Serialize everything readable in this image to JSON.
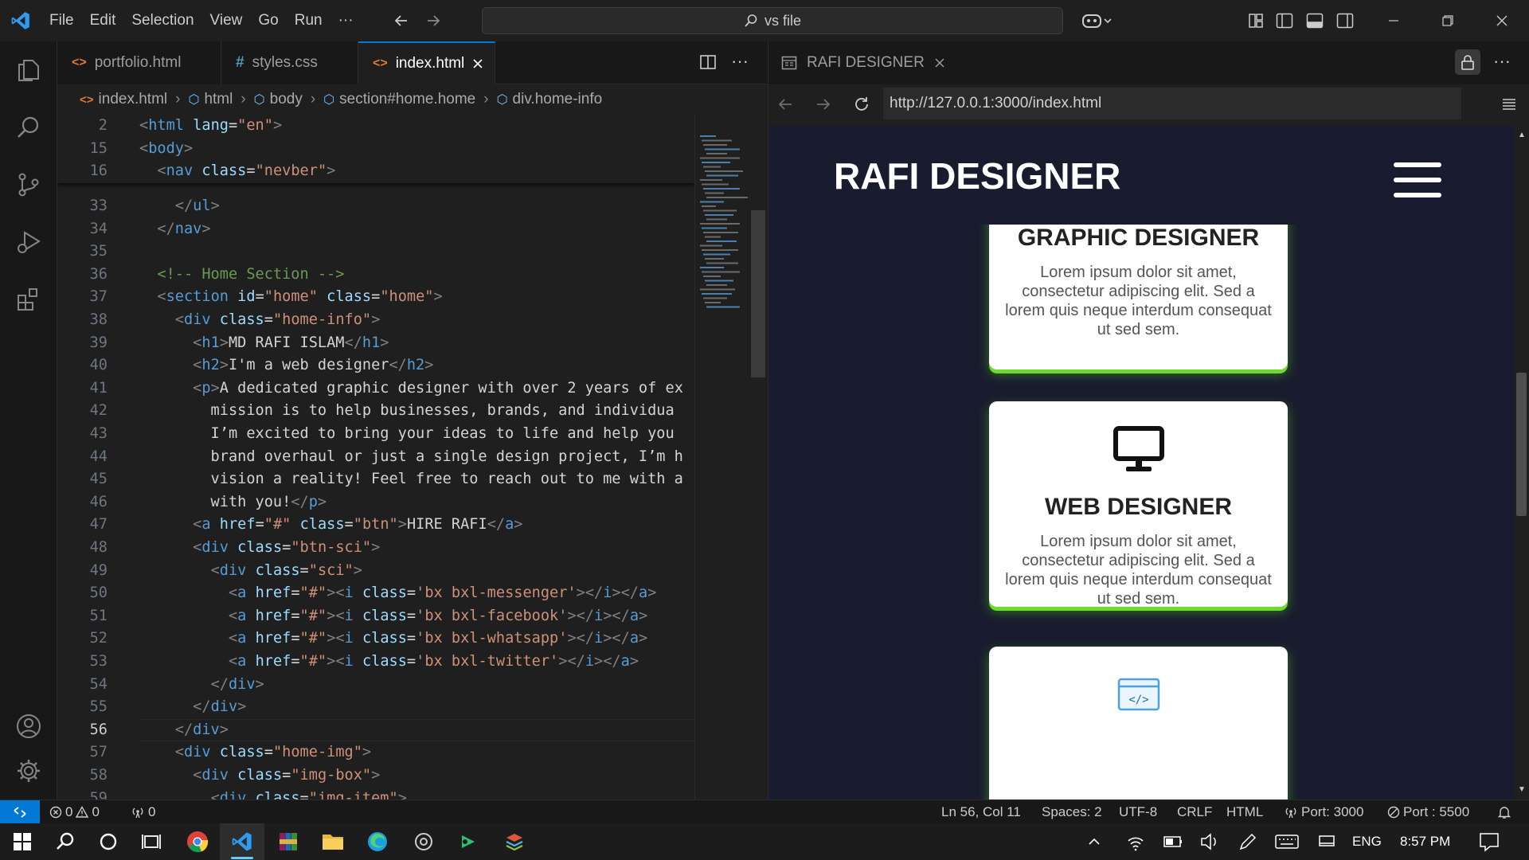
{
  "titlebar": {
    "menu": [
      "File",
      "Edit",
      "Selection",
      "View",
      "Go",
      "Run",
      "···"
    ],
    "search_text": "vs file"
  },
  "tabs": [
    {
      "label": "portfolio.html",
      "icon": "html-file-icon"
    },
    {
      "label": "styles.css",
      "icon": "css-file-icon"
    },
    {
      "label": "index.html",
      "icon": "html-file-icon",
      "active": true
    }
  ],
  "breadcrumb": [
    "index.html",
    "html",
    "body",
    "section#home.home",
    "div.home-info"
  ],
  "sticky_lines": [
    {
      "n": "2",
      "html": "<span class='t-br'>&lt;</span><span class='t-tag'>html</span> <span class='t-attr'>lang</span><span class='t-txt'>=</span><span class='t-val'>\"en\"</span><span class='t-br'>&gt;</span>"
    },
    {
      "n": "15",
      "html": "<span class='t-br'>&lt;</span><span class='t-tag'>body</span><span class='t-br'>&gt;</span>"
    },
    {
      "n": "16",
      "html": "  <span class='t-br'>&lt;</span><span class='t-tag'>nav</span> <span class='t-attr'>class</span><span class='t-txt'>=</span><span class='t-val'>\"nevber\"</span><span class='t-br'>&gt;</span>"
    }
  ],
  "code_lines": [
    {
      "n": "33",
      "html": "    <span class='t-br'>&lt;/</span><span class='t-tag'>ul</span><span class='t-br'>&gt;</span>"
    },
    {
      "n": "34",
      "html": "  <span class='t-br'>&lt;/</span><span class='t-tag'>nav</span><span class='t-br'>&gt;</span>"
    },
    {
      "n": "35",
      "html": ""
    },
    {
      "n": "36",
      "html": "  <span class='t-cmt'>&lt;!-- Home Section --&gt;</span>"
    },
    {
      "n": "37",
      "html": "  <span class='t-br'>&lt;</span><span class='t-tag'>section</span> <span class='t-attr'>id</span><span class='t-txt'>=</span><span class='t-val'>\"home\"</span> <span class='t-attr'>class</span><span class='t-txt'>=</span><span class='t-val'>\"home\"</span><span class='t-br'>&gt;</span>"
    },
    {
      "n": "38",
      "html": "    <span class='t-br'>&lt;</span><span class='t-tag'>div</span> <span class='t-attr'>class</span><span class='t-txt'>=</span><span class='t-val'>\"home-info\"</span><span class='t-br'>&gt;</span>"
    },
    {
      "n": "39",
      "html": "      <span class='t-br'>&lt;</span><span class='t-tag'>h1</span><span class='t-br'>&gt;</span><span class='t-txt'>MD RAFI ISLAM</span><span class='t-br'>&lt;/</span><span class='t-tag'>h1</span><span class='t-br'>&gt;</span>"
    },
    {
      "n": "40",
      "html": "      <span class='t-br'>&lt;</span><span class='t-tag'>h2</span><span class='t-br'>&gt;</span><span class='t-txt'>I'm a web designer</span><span class='t-br'>&lt;/</span><span class='t-tag'>h2</span><span class='t-br'>&gt;</span>"
    },
    {
      "n": "41",
      "html": "      <span class='t-br'>&lt;</span><span class='t-tag'>p</span><span class='t-br'>&gt;</span><span class='t-txt'>A dedicated graphic designer with over 2 years of ex</span>"
    },
    {
      "n": "42",
      "html": "<span class='t-txt'>        mission is to help businesses, brands, and individua</span>"
    },
    {
      "n": "43",
      "html": "<span class='t-txt'>        I’m excited to bring your ideas to life and help you</span>"
    },
    {
      "n": "44",
      "html": "<span class='t-txt'>        brand overhaul or just a single design project, I’m h</span>"
    },
    {
      "n": "45",
      "html": "<span class='t-txt'>        vision a reality! Feel free to reach out to me with a</span>"
    },
    {
      "n": "46",
      "html": "<span class='t-txt'>        with you!</span><span class='t-br'>&lt;/</span><span class='t-tag'>p</span><span class='t-br'>&gt;</span>"
    },
    {
      "n": "47",
      "html": "      <span class='t-br'>&lt;</span><span class='t-tag'>a</span> <span class='t-attr'>href</span><span class='t-txt'>=</span><span class='t-val'>\"#\"</span> <span class='t-attr'>class</span><span class='t-txt'>=</span><span class='t-val'>\"btn\"</span><span class='t-br'>&gt;</span><span class='t-txt'>HIRE RAFI</span><span class='t-br'>&lt;/</span><span class='t-tag'>a</span><span class='t-br'>&gt;</span>"
    },
    {
      "n": "48",
      "html": "      <span class='t-br'>&lt;</span><span class='t-tag'>div</span> <span class='t-attr'>class</span><span class='t-txt'>=</span><span class='t-val'>\"btn-sci\"</span><span class='t-br'>&gt;</span>"
    },
    {
      "n": "49",
      "html": "        <span class='t-br'>&lt;</span><span class='t-tag'>div</span> <span class='t-attr'>class</span><span class='t-txt'>=</span><span class='t-val'>\"sci\"</span><span class='t-br'>&gt;</span>"
    },
    {
      "n": "50",
      "html": "          <span class='t-br'>&lt;</span><span class='t-tag'>a</span> <span class='t-attr'>href</span><span class='t-txt'>=</span><span class='t-val'>\"#\"</span><span class='t-br'>&gt;&lt;</span><span class='t-tag'>i</span> <span class='t-attr'>class</span><span class='t-txt'>=</span><span class='t-val'>'bx bxl-messenger'</span><span class='t-br'>&gt;&lt;/</span><span class='t-tag'>i</span><span class='t-br'>&gt;&lt;/</span><span class='t-tag'>a</span><span class='t-br'>&gt;</span>"
    },
    {
      "n": "51",
      "html": "          <span class='t-br'>&lt;</span><span class='t-tag'>a</span> <span class='t-attr'>href</span><span class='t-txt'>=</span><span class='t-val'>\"#\"</span><span class='t-br'>&gt;&lt;</span><span class='t-tag'>i</span> <span class='t-attr'>class</span><span class='t-txt'>=</span><span class='t-val'>'bx bxl-facebook'</span><span class='t-br'>&gt;&lt;/</span><span class='t-tag'>i</span><span class='t-br'>&gt;&lt;/</span><span class='t-tag'>a</span><span class='t-br'>&gt;</span>"
    },
    {
      "n": "52",
      "html": "          <span class='t-br'>&lt;</span><span class='t-tag'>a</span> <span class='t-attr'>href</span><span class='t-txt'>=</span><span class='t-val'>\"#\"</span><span class='t-br'>&gt;&lt;</span><span class='t-tag'>i</span> <span class='t-attr'>class</span><span class='t-txt'>=</span><span class='t-val'>'bx bxl-whatsapp'</span><span class='t-br'>&gt;&lt;/</span><span class='t-tag'>i</span><span class='t-br'>&gt;&lt;/</span><span class='t-tag'>a</span><span class='t-br'>&gt;</span>"
    },
    {
      "n": "53",
      "html": "          <span class='t-br'>&lt;</span><span class='t-tag'>a</span> <span class='t-attr'>href</span><span class='t-txt'>=</span><span class='t-val'>\"#\"</span><span class='t-br'>&gt;&lt;</span><span class='t-tag'>i</span> <span class='t-attr'>class</span><span class='t-txt'>=</span><span class='t-val'>'bx bxl-twitter'</span><span class='t-br'>&gt;&lt;/</span><span class='t-tag'>i</span><span class='t-br'>&gt;&lt;/</span><span class='t-tag'>a</span><span class='t-br'>&gt;</span>"
    },
    {
      "n": "54",
      "html": "        <span class='t-br'>&lt;/</span><span class='t-tag'>div</span><span class='t-br'>&gt;</span>"
    },
    {
      "n": "55",
      "html": "      <span class='t-br'>&lt;/</span><span class='t-tag'>div</span><span class='t-br'>&gt;</span>"
    },
    {
      "n": "56",
      "html": "    <span class='t-br'>&lt;/</span><span class='t-tag'>div</span><span class='t-br'>&gt;</span>",
      "current": true
    },
    {
      "n": "57",
      "html": "    <span class='t-br'>&lt;</span><span class='t-tag'>div</span> <span class='t-attr'>class</span><span class='t-txt'>=</span><span class='t-val'>\"home-img\"</span><span class='t-br'>&gt;</span>"
    },
    {
      "n": "58",
      "html": "      <span class='t-br'>&lt;</span><span class='t-tag'>div</span> <span class='t-attr'>class</span><span class='t-txt'>=</span><span class='t-val'>\"img-box\"</span><span class='t-br'>&gt;</span>"
    },
    {
      "n": "59",
      "html": "        <span class='t-br'>&lt;</span><span class='t-tag'>div</span> <span class='t-attr'>class</span><span class='t-txt'>=</span><span class='t-val'>\"img-item\"</span><span class='t-br'>&gt;</span>"
    }
  ],
  "preview": {
    "tab_title": "RAFI DESIGNER",
    "url": "http://127.0.0.1:3000/index.html",
    "site_title": "RAFI DESIGNER",
    "cards": [
      {
        "title": "GRAPHIC DESIGNER",
        "text": "Lorem ipsum dolor sit amet, consectetur adipiscing elit. Sed a lorem quis neque interdum consequat ut sed sem.",
        "icon": "brush-icon"
      },
      {
        "title": "WEB DESIGNER",
        "text": "Lorem ipsum dolor sit amet, consectetur adipiscing elit. Sed a lorem quis neque interdum consequat ut sed sem.",
        "icon": "monitor-icon"
      },
      {
        "title": "",
        "text": "",
        "icon": "code-window-icon"
      }
    ]
  },
  "statusbar": {
    "errors": "0",
    "warnings": "0",
    "ports": "0",
    "position": "Ln 56, Col 11",
    "spaces": "Spaces: 2",
    "encoding": "UTF-8",
    "eol": "CRLF",
    "language": "HTML",
    "port_3000": "Port: 3000",
    "port_5500": "Port : 5500"
  },
  "taskbar": {
    "lang": "ENG",
    "time": "8:57 PM"
  },
  "colors": {
    "accent": "#0078d4",
    "card_glow": "#6fd92e",
    "preview_bg": "#191c2e"
  }
}
